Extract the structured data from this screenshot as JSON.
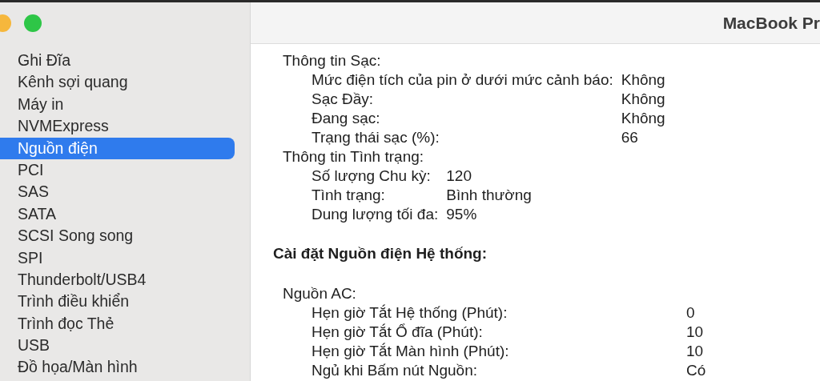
{
  "window": {
    "title": "MacBook Pr",
    "controls": [
      {
        "kind": "minimize"
      },
      {
        "kind": "zoom"
      }
    ]
  },
  "sidebar": {
    "items": [
      {
        "label": "Ghi Đĩa",
        "selected": false
      },
      {
        "label": "Kênh sợi quang",
        "selected": false
      },
      {
        "label": "Máy in",
        "selected": false
      },
      {
        "label": "NVMExpress",
        "selected": false
      },
      {
        "label": "Nguồn điện",
        "selected": true
      },
      {
        "label": "PCI",
        "selected": false
      },
      {
        "label": "SAS",
        "selected": false
      },
      {
        "label": "SATA",
        "selected": false
      },
      {
        "label": "SCSI Song song",
        "selected": false
      },
      {
        "label": "SPI",
        "selected": false
      },
      {
        "label": "Thunderbolt/USB4",
        "selected": false
      },
      {
        "label": "Trình điều khiển",
        "selected": false
      },
      {
        "label": "Trình đọc Thẻ",
        "selected": false
      },
      {
        "label": "USB",
        "selected": false
      },
      {
        "label": "Đồ họa/Màn hình",
        "selected": false
      }
    ]
  },
  "content": [
    {
      "kind": "group",
      "title": "Thông tin Sạc:",
      "rows": [
        {
          "label": "Mức điện tích của pin ở dưới mức cảnh báo:",
          "value": "Không"
        },
        {
          "label": "Sạc Đầy:",
          "value": "Không"
        },
        {
          "label": "Đang sạc:",
          "value": "Không"
        },
        {
          "label": "Trạng thái sạc (%):",
          "value": "66"
        }
      ]
    },
    {
      "kind": "group",
      "title": "Thông tin Tình trạng:",
      "rows": [
        {
          "label": "Số lượng Chu kỳ:",
          "value": "120"
        },
        {
          "label": "Tình trạng:",
          "value": "Bình thường"
        },
        {
          "label": "Dung lượng tối đa:",
          "value": "95%"
        }
      ]
    },
    {
      "kind": "heading",
      "title": "Cài đặt Nguồn điện Hệ thống:"
    },
    {
      "kind": "group",
      "title": "Nguồn AC:",
      "rows": [
        {
          "label": "Hẹn giờ Tắt Hệ thống (Phút):",
          "value": "0"
        },
        {
          "label": "Hẹn giờ Tắt Ổ đĩa (Phút):",
          "value": "10"
        },
        {
          "label": "Hẹn giờ Tắt Màn hình (Phút):",
          "value": "10"
        },
        {
          "label": "Ngủ khi Bấm nút Nguồn:",
          "value": "Có"
        }
      ]
    }
  ]
}
